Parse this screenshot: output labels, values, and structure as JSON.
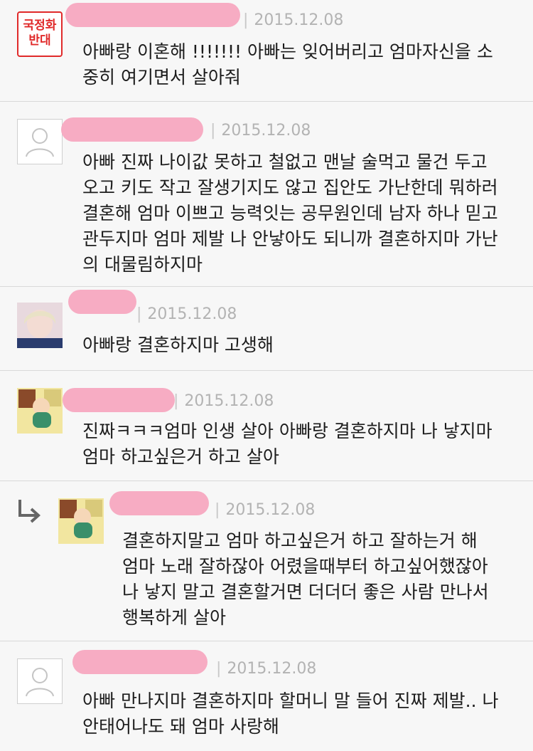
{
  "comments": [
    {
      "avatar": "stamp",
      "stamp_lines": [
        "국정화",
        "반대"
      ],
      "separator": "|",
      "date": "2015.12.08",
      "text": "아빠랑 이혼해 !!!!!!! 아빠는 잊어버리고 엄마자신을 소\n중히 여기면서 살아줘"
    },
    {
      "avatar": "default-user-icon",
      "separator": "|",
      "date": "2015.12.08",
      "text": "아빠 진짜 나이값 못하고 철없고 맨날 술먹고 물건 두고\n오고 키도 작고 잘생기지도 않고 집안도 가난한데 뭐하러\n결혼해 엄마 이쁘고 능력잇는 공무원인데 남자 하나 믿고\n관두지마 엄마 제발 나 안낳아도 되니까 결혼하지마 가난\n의 대물림하지마"
    },
    {
      "avatar": "blond-person-photo",
      "separator": "|",
      "date": "2015.12.08",
      "text": "아빠랑 결혼하지마 고생해"
    },
    {
      "avatar": "cartoon-character-image",
      "separator": "|",
      "date": "2015.12.08",
      "text": "진짜ㅋㅋㅋ엄마 인생 살아 아빠랑 결혼하지마 나 낳지마\n엄마 하고싶은거 하고 살아"
    },
    {
      "avatar": "cartoon-character-image",
      "reply_icon": "reply-arrow-icon",
      "separator": "|",
      "date": "2015.12.08",
      "text": "결혼하지말고 엄마 하고싶은거 하고 잘하는거 해\n엄마 노래 잘하잖아 어렸을때부터 하고싶어했잖아\n나 낳지 말고 결혼할거면 더더더 좋은 사람 만나서\n행복하게 살아"
    },
    {
      "avatar": "default-user-icon",
      "separator": "|",
      "date": "2015.12.08",
      "text": "아빠 만나지마 결혼하지마 할머니 말 들어 진짜 제발.. 나\n안태어나도 돼 엄마 사랑해"
    }
  ],
  "colors": {
    "background": "#f7f7f7",
    "name_redaction": "#f7a8c0",
    "date": "#b3b3b3",
    "stamp": "#e02a2a"
  }
}
